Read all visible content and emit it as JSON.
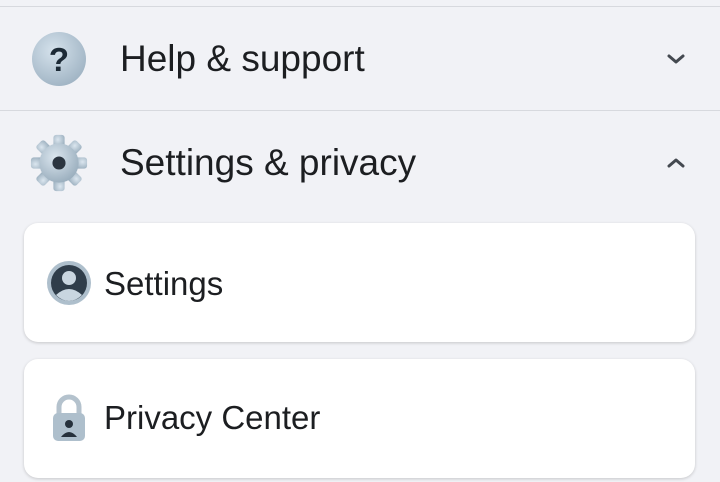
{
  "menu": {
    "help": {
      "label": "Help & support",
      "icon": "question-icon",
      "expanded": false
    },
    "settings_privacy": {
      "label": "Settings & privacy",
      "icon": "gear-icon",
      "expanded": true,
      "items": [
        {
          "label": "Settings",
          "icon": "profile-icon"
        },
        {
          "label": "Privacy Center",
          "icon": "lock-icon"
        }
      ]
    }
  },
  "colors": {
    "background": "#f1f2f6",
    "card": "#ffffff",
    "text": "#1c1e21",
    "divider": "#d7d9de"
  }
}
